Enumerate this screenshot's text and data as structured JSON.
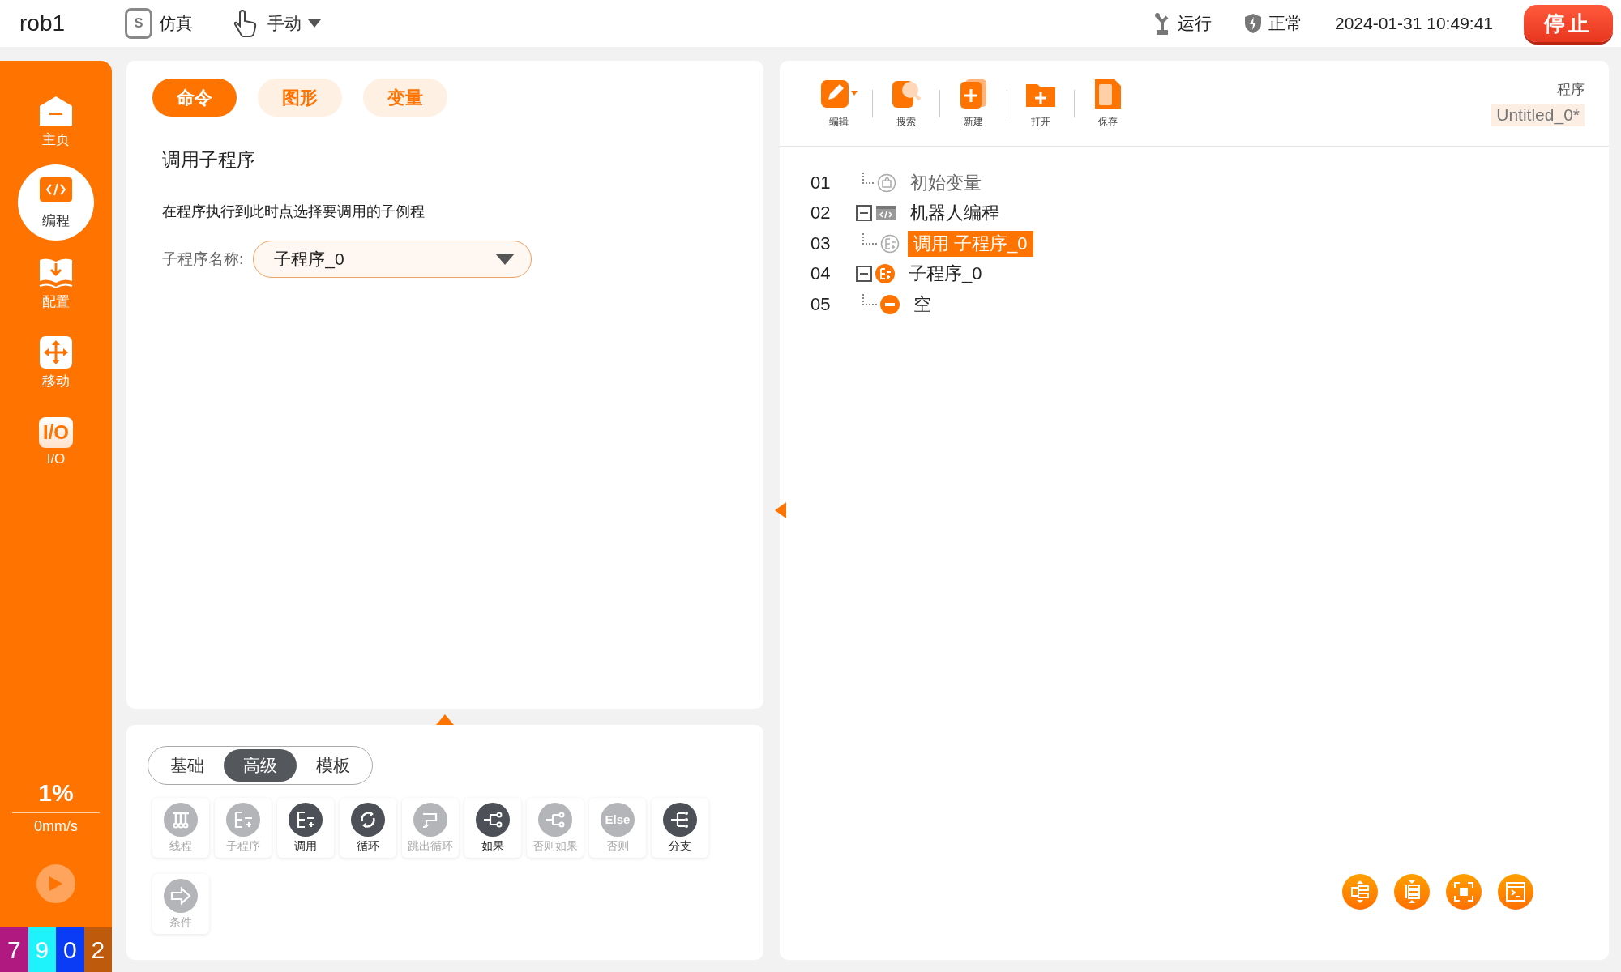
{
  "top_bar": {
    "robot": "rob1",
    "mode": {
      "glyph": "S",
      "label": "仿真"
    },
    "control": {
      "label": "手动"
    },
    "status": [
      {
        "kind": "robot",
        "label": "运行"
      },
      {
        "kind": "shield",
        "label": "正常"
      }
    ],
    "datetime": "2024-01-31 10:49:41",
    "stop_button": "停止"
  },
  "sidebar": {
    "items": [
      {
        "kind": "home",
        "label": "主页",
        "selected": false
      },
      {
        "kind": "code",
        "label": "编程",
        "selected": true
      },
      {
        "kind": "config",
        "label": "配置",
        "selected": false
      },
      {
        "kind": "move",
        "label": "移动",
        "selected": false
      },
      {
        "kind": "io",
        "glyph": "I/O",
        "label": "I/O",
        "selected": false
      }
    ],
    "speed_percent": "1%",
    "speed": "0mm/s",
    "digits": [
      {
        "text": "7",
        "color": "#b0197f"
      },
      {
        "text": "9",
        "color": "#1ef2fa"
      },
      {
        "text": "0",
        "color": "#0a3cf5"
      },
      {
        "text": "2",
        "color": "#bd5a0c"
      }
    ]
  },
  "editor": {
    "tabs": [
      {
        "label": "命令",
        "selected": true
      },
      {
        "label": "图形",
        "selected": false
      },
      {
        "label": "变量",
        "selected": false
      }
    ],
    "title": "调用子程序",
    "description": "在程序执行到此时点选择要调用的子例程",
    "field": {
      "label": "子程序名称:",
      "value": "子程序_0"
    }
  },
  "palette": {
    "tabs": [
      {
        "label": "基础",
        "selected": false
      },
      {
        "label": "高级",
        "selected": true
      },
      {
        "label": "模板",
        "selected": false
      }
    ],
    "items": [
      {
        "kind": "thread",
        "label": "线程",
        "disabled": true
      },
      {
        "kind": "subroutine",
        "label": "子程序",
        "disabled": true
      },
      {
        "kind": "call",
        "label": "调用",
        "disabled": false
      },
      {
        "kind": "loop",
        "label": "循环",
        "disabled": false
      },
      {
        "kind": "break",
        "label": "跳出循环",
        "disabled": true
      },
      {
        "kind": "if",
        "label": "如果",
        "disabled": false
      },
      {
        "kind": "elseif",
        "label": "否则如果",
        "disabled": true
      },
      {
        "kind": "else",
        "glyph": "Else",
        "label": "否则",
        "disabled": true
      },
      {
        "kind": "switch",
        "label": "分支",
        "disabled": false
      },
      {
        "kind": "condition",
        "label": "条件",
        "disabled": true
      }
    ]
  },
  "program": {
    "toolbar": [
      {
        "kind": "edit",
        "label": "编辑"
      },
      {
        "kind": "search",
        "label": "搜索"
      },
      {
        "kind": "new",
        "label": "新建"
      },
      {
        "kind": "open",
        "label": "打开"
      },
      {
        "kind": "save",
        "label": "保存"
      }
    ],
    "program_label": "程序",
    "program_name": "Untitled_0*",
    "tree": [
      {
        "line": "01",
        "label": "初始变量",
        "kind": "variables",
        "selected": false
      },
      {
        "line": "02",
        "label": "机器人编程",
        "kind": "program",
        "selected": false,
        "expanded": true,
        "children": [
          {
            "line": "03",
            "label": "调用 子程序_0",
            "kind": "call",
            "selected": true
          }
        ]
      },
      {
        "line": "04",
        "label": "子程序_0",
        "kind": "subroutine",
        "selected": false,
        "expanded": true,
        "children": [
          {
            "line": "05",
            "label": "空",
            "kind": "empty",
            "selected": false
          }
        ]
      }
    ]
  }
}
